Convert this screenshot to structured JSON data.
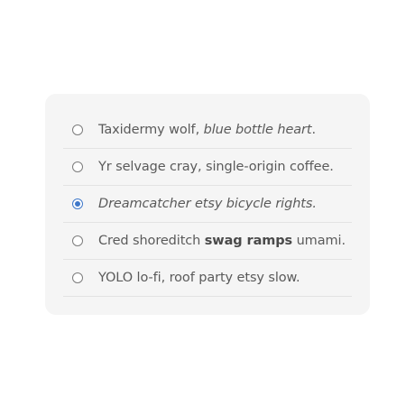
{
  "options": [
    {
      "text": "Taxidermy wolf, ",
      "em": "blue bottle heart",
      "tail": ".",
      "checked": false
    },
    {
      "text": "Yr selvage cray, single-origin coffee.",
      "checked": false
    },
    {
      "em": "Dreamcatcher etsy bicycle rights.",
      "checked": true
    },
    {
      "text": "Cred shoreditch ",
      "strong": "swag ramps",
      "tail": " umami.",
      "checked": false
    },
    {
      "text": "YOLO lo-fi, roof party etsy slow.",
      "checked": false
    }
  ],
  "colors": {
    "accent": "#3f78c9",
    "card_background": "#f5f5f5",
    "text": "#5a5a5a"
  },
  "icons": {
    "radio_unchecked": "radio-unchecked-icon",
    "radio_checked": "radio-checked-icon"
  }
}
